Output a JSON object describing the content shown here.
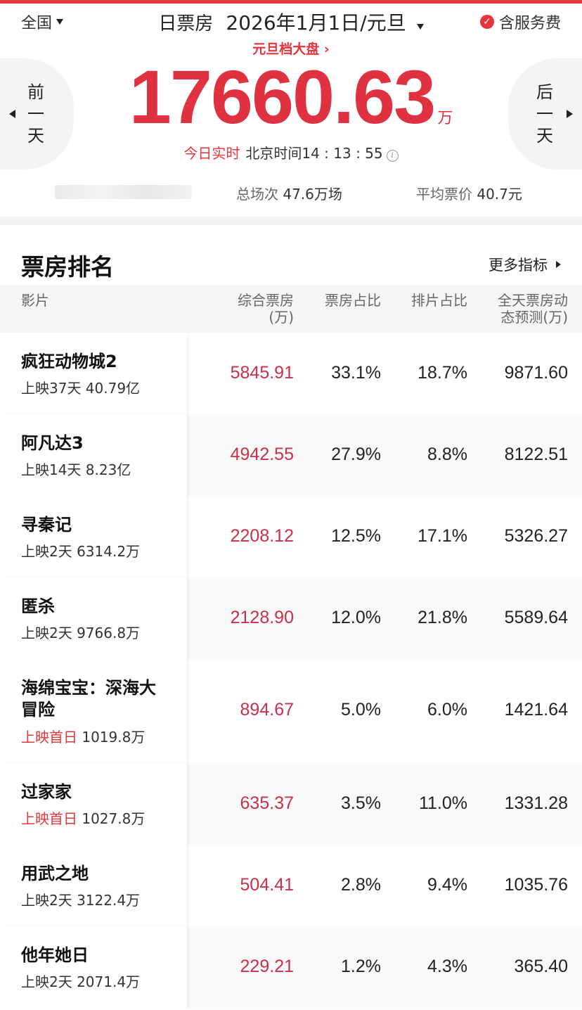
{
  "header": {
    "region": "全国",
    "title_label": "日票房",
    "date": "2026年1月1日/元旦",
    "service_fee": "含服务费",
    "period_link": "元旦档大盘",
    "prev_day": "前\n一\n天",
    "next_day": "后\n一\n天",
    "total_box_office": "17660.63",
    "unit": "万",
    "realtime_label": "今日实时",
    "beijing_time": "北京时间14 : 13 : 55",
    "total_shows_label": "总场次",
    "total_shows": "47.6万场",
    "avg_price_label": "平均票价",
    "avg_price": "40.7元"
  },
  "ranking": {
    "title": "票房排名",
    "more": "更多指标",
    "columns": {
      "film": "影片",
      "box": "综合票房\n(万)",
      "share": "票房占比",
      "schedule": "排片占比",
      "prediction": "全天票房动\n态预测(万)"
    },
    "rows": [
      {
        "name": "疯狂动物城2",
        "first_day": "",
        "release": "上映37天 40.79亿",
        "box": "5845.91",
        "share": "33.1%",
        "schedule": "18.7%",
        "prediction": "9871.60"
      },
      {
        "name": "阿凡达3",
        "first_day": "",
        "release": "上映14天 8.23亿",
        "box": "4942.55",
        "share": "27.9%",
        "schedule": "8.8%",
        "prediction": "8122.51"
      },
      {
        "name": "寻秦记",
        "first_day": "",
        "release": "上映2天 6314.2万",
        "box": "2208.12",
        "share": "12.5%",
        "schedule": "17.1%",
        "prediction": "5326.27"
      },
      {
        "name": "匿杀",
        "first_day": "",
        "release": "上映2天 9766.8万",
        "box": "2128.90",
        "share": "12.0%",
        "schedule": "21.8%",
        "prediction": "5589.64"
      },
      {
        "name": "海绵宝宝：深海大冒险",
        "first_day": "上映首日",
        "release": " 1019.8万",
        "box": "894.67",
        "share": "5.0%",
        "schedule": "6.0%",
        "prediction": "1421.64"
      },
      {
        "name": "过家家",
        "first_day": "上映首日",
        "release": " 1027.8万",
        "box": "635.37",
        "share": "3.5%",
        "schedule": "11.0%",
        "prediction": "1331.28"
      },
      {
        "name": "用武之地",
        "first_day": "",
        "release": "上映2天 3122.4万",
        "box": "504.41",
        "share": "2.8%",
        "schedule": "9.4%",
        "prediction": "1035.76"
      },
      {
        "name": "他年她日",
        "first_day": "",
        "release": "上映2天 2071.4万",
        "box": "229.21",
        "share": "1.2%",
        "schedule": "4.3%",
        "prediction": "365.40"
      }
    ]
  },
  "colors": {
    "accent": "#e8343c",
    "box_value": "#c8304a"
  }
}
